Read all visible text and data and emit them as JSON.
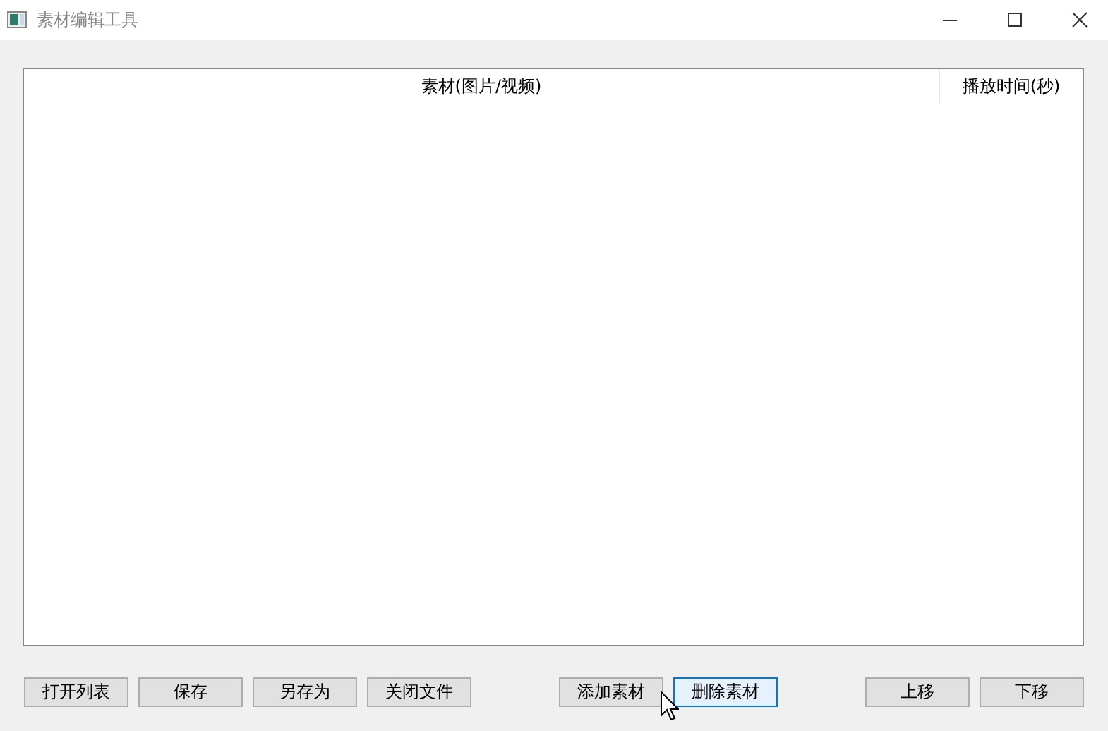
{
  "window": {
    "title": "素材编辑工具"
  },
  "table": {
    "columns": [
      "素材(图片/视频)",
      "播放时间(秒)"
    ]
  },
  "button_groups": [
    {
      "buttons": [
        {
          "label": "打开列表",
          "focused": false
        },
        {
          "label": "保存",
          "focused": false
        },
        {
          "label": "另存为",
          "focused": false
        },
        {
          "label": "关闭文件",
          "focused": false
        }
      ]
    },
    {
      "buttons": [
        {
          "label": "添加素材",
          "focused": false
        },
        {
          "label": "删除素材",
          "focused": true
        }
      ]
    },
    {
      "buttons": [
        {
          "label": "上移",
          "focused": false
        },
        {
          "label": "下移",
          "focused": false
        }
      ]
    }
  ]
}
